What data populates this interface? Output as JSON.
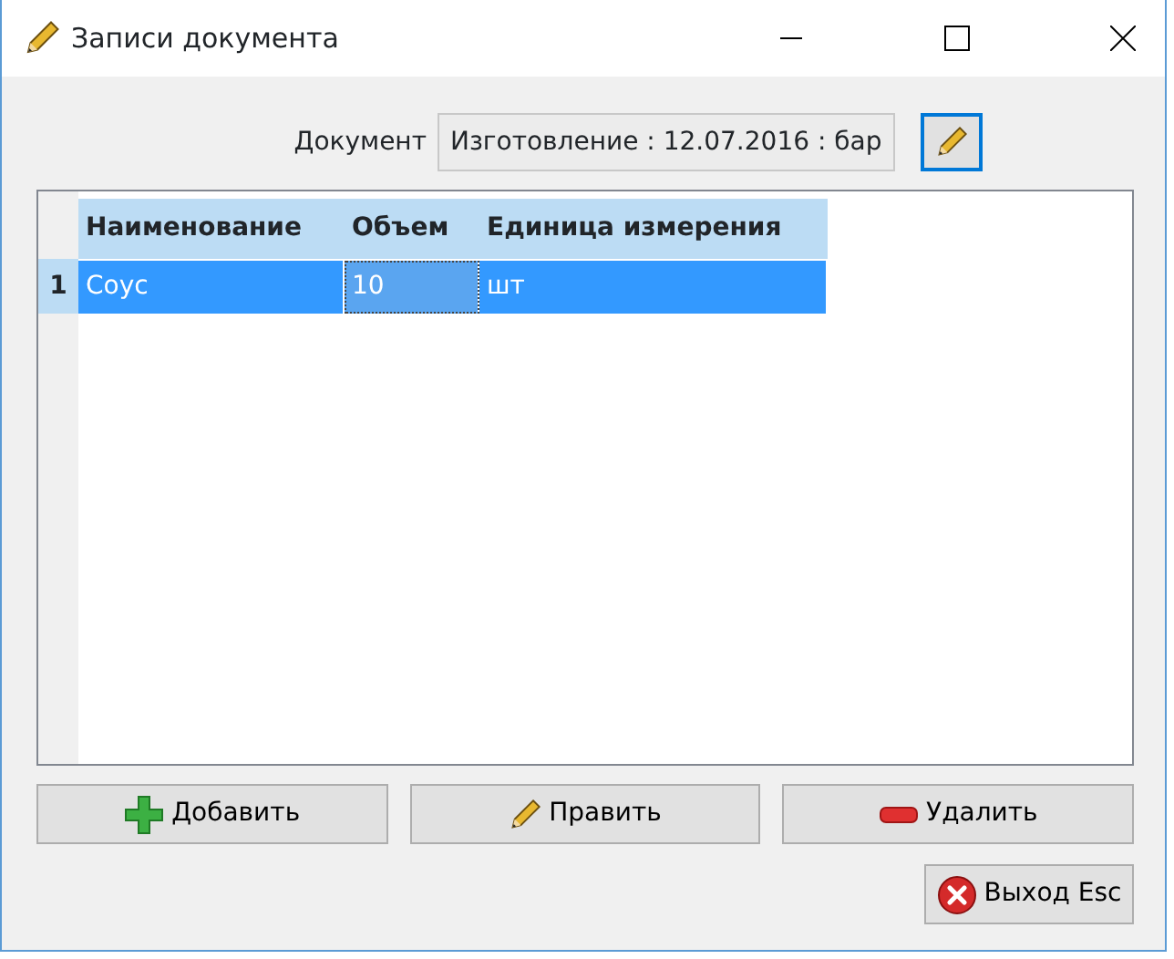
{
  "window": {
    "title": "Записи документа",
    "controls": [
      {
        "kind": "minimize"
      },
      {
        "kind": "maximize"
      },
      {
        "kind": "close"
      }
    ]
  },
  "document": {
    "label": "Документ",
    "value": "Изготовление : 12.07.2016 : бар"
  },
  "table": {
    "columns": [
      "Наименование",
      "Объем",
      "Единица измерения"
    ],
    "rows": [
      {
        "number": "1",
        "selected": true,
        "cells": [
          {
            "text": "Соус",
            "focused": false
          },
          {
            "text": "10",
            "focused": true
          },
          {
            "text": "шт",
            "focused": false
          }
        ]
      }
    ]
  },
  "actions": [
    {
      "kind": "add",
      "label": "Добавить"
    },
    {
      "kind": "edit",
      "label": "Править"
    },
    {
      "kind": "delete",
      "label": "Удалить"
    }
  ],
  "exit": {
    "kind": "exit",
    "label": "Выход Esc"
  }
}
